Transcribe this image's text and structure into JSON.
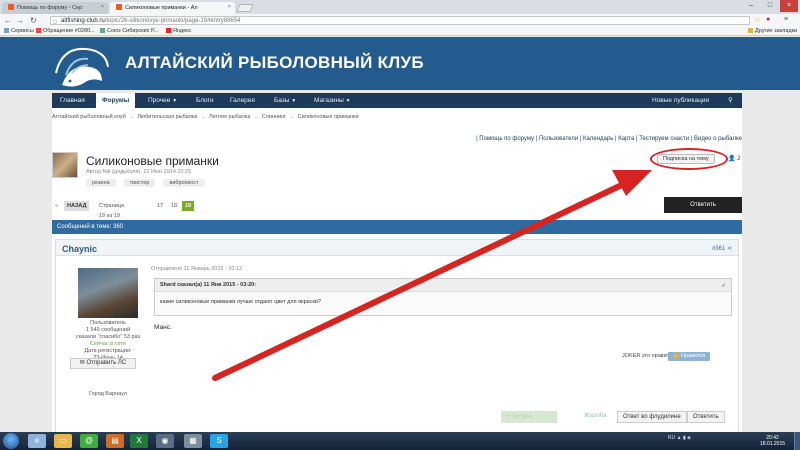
{
  "browser": {
    "tabs": [
      {
        "label": "Помощь по форуму - Сер"
      },
      {
        "label": "Силиконовые приманки - Ал"
      }
    ],
    "url_host": "altfishing-club.ru",
    "url_path": "/topic/26-silikonovye-primanki/page-19#entry88654",
    "bookmarks": [
      "Сервисы",
      "Обращение #0280...",
      "Союз Сибирских Р...",
      "Яндекс"
    ],
    "other_bookmarks": "Другие закладки"
  },
  "site": {
    "title": "АЛТАЙСКИЙ РЫБОЛОВНЫЙ КЛУБ",
    "nav": [
      {
        "label": "Главная"
      },
      {
        "label": "Форумы"
      },
      {
        "label": "Прочее"
      },
      {
        "label": "Блоги"
      },
      {
        "label": "Галерея"
      },
      {
        "label": "Базы"
      },
      {
        "label": "Магазины"
      }
    ],
    "nav_right": "Новые публикации"
  },
  "breadcrumb": [
    "Алтайский рыболовный клуб",
    "Любительская рыбалка",
    "Летняя рыбалка",
    "Спиннинг",
    "Силиконовые приманки"
  ],
  "helplinks": [
    "Помощь по форуму",
    "Пользователи",
    "Календарь",
    "Карта",
    "Тестируем снасти",
    "Видео о рыбалке"
  ],
  "topic": {
    "title": "Силиконовые приманки",
    "meta": "Автор Nik (дядьКоля), 22 Июн 2014 20:25",
    "tags": [
      "резина",
      "твистер",
      "виброхвост"
    ],
    "follow_label": "Подписка на тему",
    "follow_count": "2"
  },
  "pager": {
    "prev": "НАЗАД",
    "page_info": "Страница 19 из 19",
    "pages": [
      "17",
      "18",
      "19"
    ],
    "current": "19"
  },
  "reply_label": "Ответить",
  "messages_count": "Сообщений в теме: 360",
  "post": {
    "author": "Chaynic",
    "number": "#361",
    "role": "Пользователь",
    "posts_count": "1 549 сообщений",
    "thanks": "сказали \"спасибо\" 53 раз",
    "status": "Сейчас в сети",
    "reg_label": "Дата регистрации:",
    "reg_date": "23-Июнь 14",
    "pm_label": "Отправить ЛС",
    "city": "Город Барнаул",
    "date": "Отправлено 11 Январь 2015 - 10:12",
    "quote_head": "Shard сказал(а) 11 Янв 2015 - 03:20:",
    "quote_text": "какие силиконовые приманки лучше  отдают цвет для окраски?",
    "body": "Манс.",
    "like_text": "JOKER это нравится",
    "like_btn": "Нравится",
    "actions": {
      "quote": "Цитата",
      "complain": "Жалоба",
      "fast_reply": "Ответ во флудилине",
      "reply": "Ответить"
    }
  },
  "taskbar": {
    "lang": "RU",
    "time": "20:42",
    "date": "18.01.2015"
  },
  "colors": {
    "header": "#235b8e",
    "nav": "#1d3a5a",
    "accent_green": "#7aad26",
    "annotation_red": "#d9231e"
  }
}
